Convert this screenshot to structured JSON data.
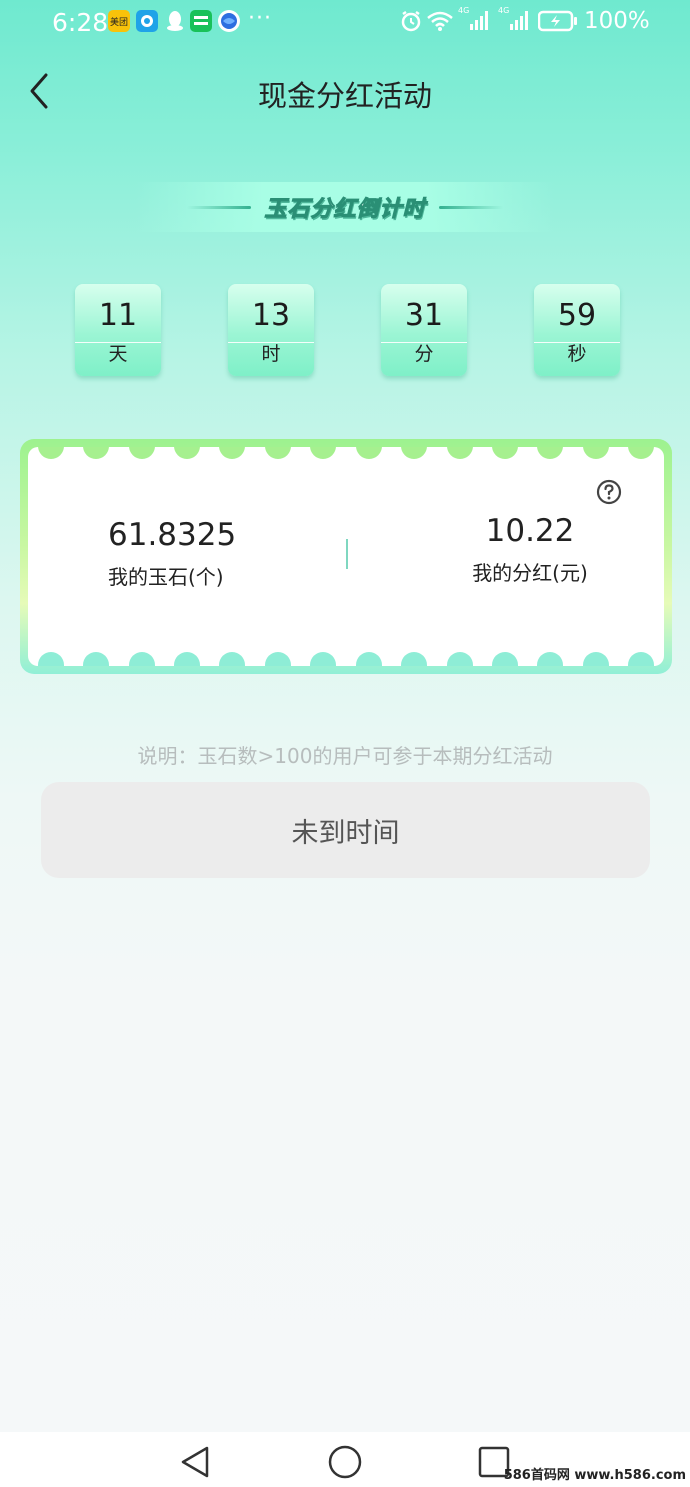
{
  "status_bar": {
    "time": "6:28",
    "apps": [
      {
        "name": "meituan-app-icon",
        "label": "美团",
        "color": "#f8c20a"
      },
      {
        "name": "messenger-app-icon",
        "label": "",
        "color": "#1fa3e8"
      },
      {
        "name": "qq-app-icon",
        "label": "",
        "color": "#ffffff"
      },
      {
        "name": "iqiyi-app-icon",
        "label": "",
        "color": "#19c15a"
      },
      {
        "name": "browser-app-icon",
        "label": "",
        "color": "#2d6fe0"
      }
    ],
    "more": "···",
    "network_1": "4G",
    "network_2": "4G",
    "battery": "100%"
  },
  "header": {
    "title": "现金分红活动"
  },
  "countdown": {
    "banner_title": "玉石分红倒计时",
    "items": [
      {
        "value": "11",
        "unit": "天"
      },
      {
        "value": "13",
        "unit": "时"
      },
      {
        "value": "31",
        "unit": "分"
      },
      {
        "value": "59",
        "unit": "秒"
      }
    ]
  },
  "card": {
    "jade": {
      "value": "61.8325",
      "label": "我的玉石(个)"
    },
    "bonus": {
      "value": "10.22",
      "label": "我的分红(元)"
    }
  },
  "note": "说明：玉石数>100的用户可参于本期分红活动",
  "action_button": "未到时间",
  "watermark": "586首码网 www.h586.com",
  "colors": {
    "accent": "#7ff0c8",
    "button_bg": "#ececec"
  }
}
